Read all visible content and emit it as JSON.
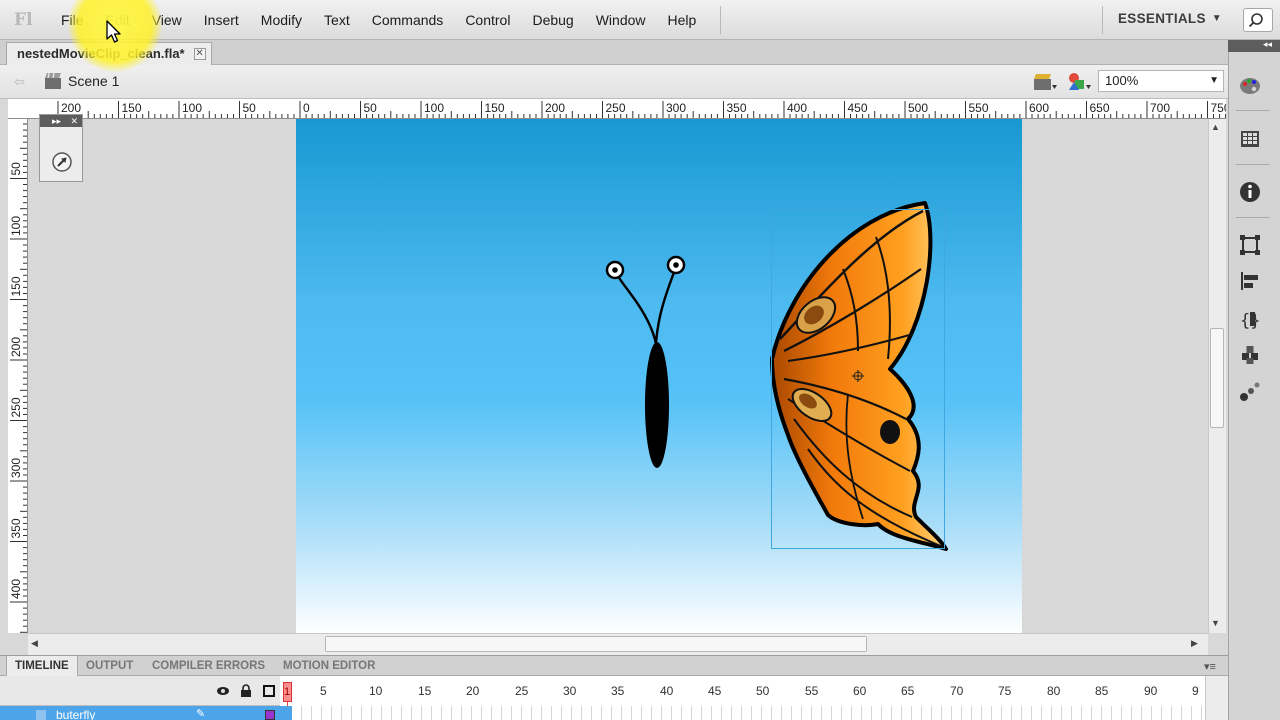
{
  "app": {
    "logo": "Fl"
  },
  "menu": {
    "items": [
      "File",
      "Edit",
      "View",
      "Insert",
      "Modify",
      "Text",
      "Commands",
      "Control",
      "Debug",
      "Window",
      "Help"
    ],
    "workspace": "ESSENTIALS"
  },
  "document": {
    "tab_title": "nestedMovieClip_clean.fla*",
    "close_glyph": "✕"
  },
  "editbar": {
    "scene_label": "Scene 1",
    "zoom": "100%"
  },
  "rulers": {
    "h_labels": [
      "200",
      "150",
      "100",
      "50",
      "0",
      "50",
      "100",
      "150",
      "200",
      "250",
      "300",
      "350",
      "400",
      "450",
      "500",
      "550",
      "600",
      "650",
      "700",
      "750"
    ],
    "v_labels": [
      "50",
      "100",
      "150",
      "200",
      "250",
      "300",
      "350",
      "400"
    ]
  },
  "timeline": {
    "tabs": [
      "TIMELINE",
      "OUTPUT",
      "COMPILER ERRORS",
      "MOTION EDITOR"
    ],
    "frame_numbers": [
      "1",
      "5",
      "10",
      "15",
      "20",
      "25",
      "30",
      "35",
      "40",
      "45",
      "50",
      "55",
      "60",
      "65",
      "70",
      "75",
      "80",
      "85",
      "90",
      "9"
    ],
    "layer_name": "buterfly",
    "layer_color": "#9933cc"
  },
  "colors": {
    "stage_top": "#1898d2",
    "stage_mid": "#56c2f7",
    "wing_orange": "#f68a10",
    "selection": "#3fa8e0",
    "highlight": "#fff028"
  },
  "icons": {
    "dock": [
      "color-palette-icon",
      "swatches-icon",
      "info-icon",
      "transform-icon",
      "align-icon",
      "code-snippets-icon",
      "components-icon",
      "motion-presets-icon"
    ]
  }
}
